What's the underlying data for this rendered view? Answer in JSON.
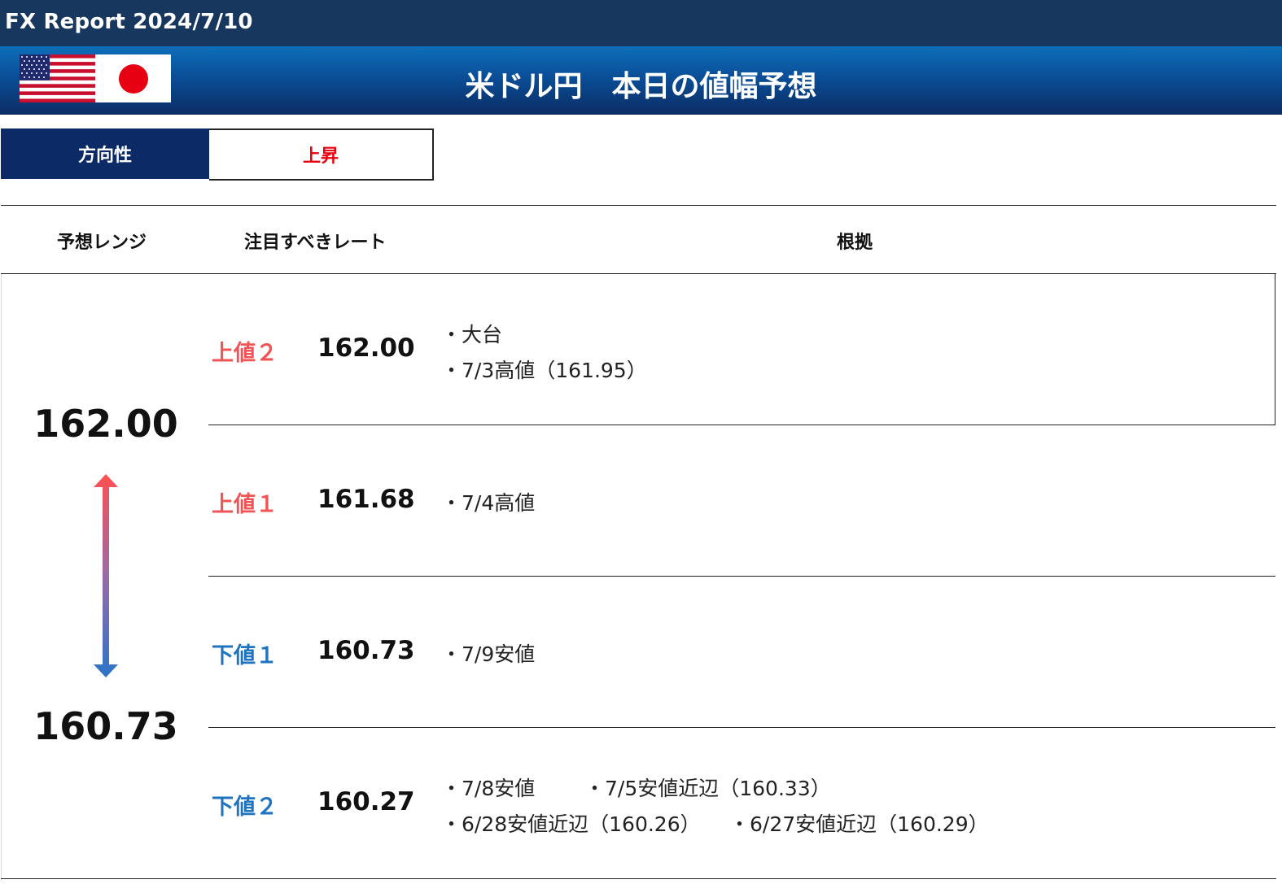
{
  "header": {
    "report_title": "FX Report 2024/7/10",
    "main_title": "米ドル円　本日の値幅予想"
  },
  "direction": {
    "label": "方向性",
    "value": "上昇"
  },
  "columns": {
    "range": "予想レンジ",
    "rates": "注目すべきレート",
    "basis": "根拠"
  },
  "range": {
    "high": "162.00",
    "low": "160.73"
  },
  "rows": [
    {
      "label": "上値２",
      "rate": "162.00",
      "basis": [
        "・大台",
        "・7/3高値（161.95）"
      ]
    },
    {
      "label": "上値１",
      "rate": "161.68",
      "basis": [
        "・7/4高値"
      ]
    },
    {
      "label": "下値１",
      "rate": "160.73",
      "basis": [
        "・7/9安値"
      ]
    },
    {
      "label": "下値２",
      "rate": "160.27",
      "basis": [
        "・7/8安値",
        "・7/5安値近辺（160.33）",
        "・6/28安値近辺（160.26）",
        "・6/27安値近辺（160.29）"
      ]
    }
  ],
  "colors": {
    "header_dark": "#17375e",
    "band_blue": "#0a4e97",
    "label_navy": "#0c2a66",
    "rise_red": "#e8000e",
    "upper_label": "#f05456",
    "lower_label": "#1f73bf"
  },
  "icons": {
    "flag_left": "us-flag-icon",
    "flag_right": "japan-flag-icon",
    "range_arrow": "double-arrow-icon"
  }
}
